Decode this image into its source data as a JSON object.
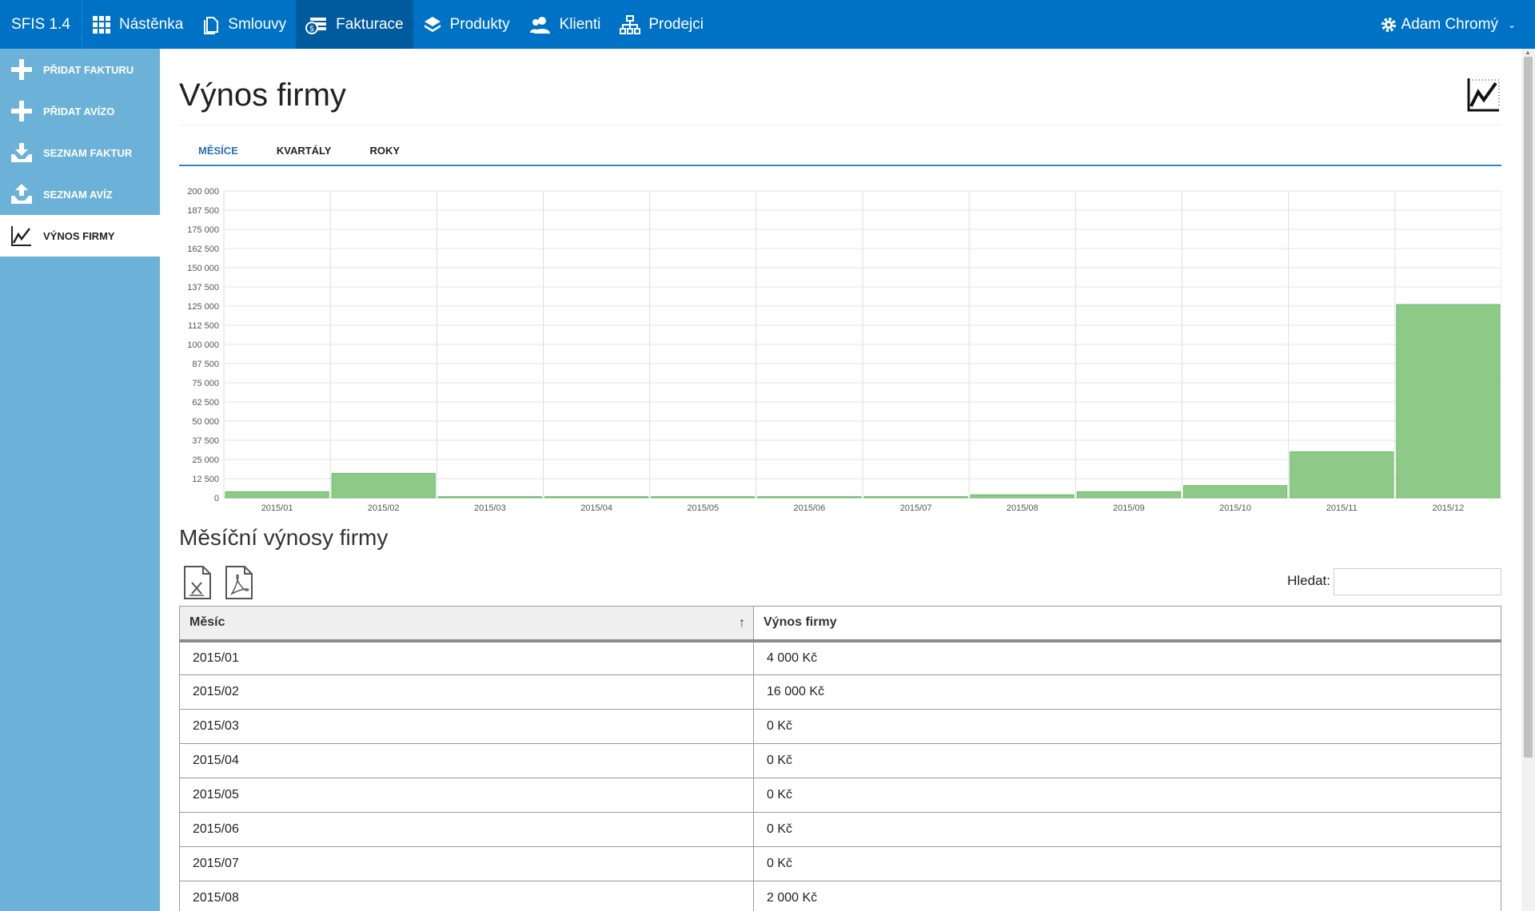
{
  "app": {
    "brand": "SFIS 1.4"
  },
  "nav": {
    "items": [
      {
        "label": "Nástěnka",
        "icon": "grid-icon"
      },
      {
        "label": "Smlouvy",
        "icon": "document-icon"
      },
      {
        "label": "Fakturace",
        "icon": "money-icon",
        "active": true
      },
      {
        "label": "Produkty",
        "icon": "layers-icon"
      },
      {
        "label": "Klienti",
        "icon": "users-icon"
      },
      {
        "label": "Prodejci",
        "icon": "hierarchy-icon"
      }
    ]
  },
  "user": {
    "name": "Adam Chromý",
    "icon": "gear-icon"
  },
  "sidebar": {
    "items": [
      {
        "label": "PŘIDAT FAKTURU",
        "icon": "plus-icon"
      },
      {
        "label": "PŘIDAT AVÍZO",
        "icon": "plus-icon"
      },
      {
        "label": "SEZNAM FAKTUR",
        "icon": "tray-download-icon"
      },
      {
        "label": "SEZNAM AVÍZ",
        "icon": "tray-upload-icon"
      },
      {
        "label": "VÝNOS FIRMY",
        "icon": "line-chart-icon",
        "active": true
      }
    ]
  },
  "page": {
    "title": "Výnos firmy",
    "subtitle": "Měsíční výnosy firmy"
  },
  "tabs": [
    {
      "label": "MĚSÍCE",
      "active": true
    },
    {
      "label": "KVARTÁLY"
    },
    {
      "label": "ROKY"
    }
  ],
  "search": {
    "label": "Hledat:",
    "value": ""
  },
  "exports": {
    "excel_icon": "excel-file-icon",
    "pdf_icon": "pdf-file-icon"
  },
  "table": {
    "columns": [
      "Měsíc",
      "Výnos firmy"
    ],
    "rows": [
      [
        "2015/01",
        "4 000 Kč"
      ],
      [
        "2015/02",
        "16 000 Kč"
      ],
      [
        "2015/03",
        "0 Kč"
      ],
      [
        "2015/04",
        "0 Kč"
      ],
      [
        "2015/05",
        "0 Kč"
      ],
      [
        "2015/06",
        "0 Kč"
      ],
      [
        "2015/07",
        "0 Kč"
      ],
      [
        "2015/08",
        "2 000 Kč"
      ]
    ]
  },
  "colors": {
    "topbar": "#0072c6",
    "topbar_active": "#005a9e",
    "sidebar": "#6cb2d8",
    "bar_fill": "#8dca87",
    "bar_stroke": "#6cb86b",
    "tab_accent": "#2e89c6"
  },
  "chart_data": {
    "type": "bar",
    "categories": [
      "2015/01",
      "2015/02",
      "2015/03",
      "2015/04",
      "2015/05",
      "2015/06",
      "2015/07",
      "2015/08",
      "2015/09",
      "2015/10",
      "2015/11",
      "2015/12"
    ],
    "values": [
      4000,
      16000,
      0,
      0,
      0,
      0,
      0,
      2000,
      4000,
      8000,
      30000,
      126000
    ],
    "yticks": [
      "0",
      "12 500",
      "25 000",
      "37 500",
      "50 000",
      "62 500",
      "75 000",
      "87 500",
      "100 000",
      "112 500",
      "125 000",
      "137 500",
      "150 000",
      "162 500",
      "175 000",
      "187 500",
      "200 000"
    ],
    "ylim": [
      0,
      200000
    ],
    "grid": true,
    "legend": "none"
  }
}
